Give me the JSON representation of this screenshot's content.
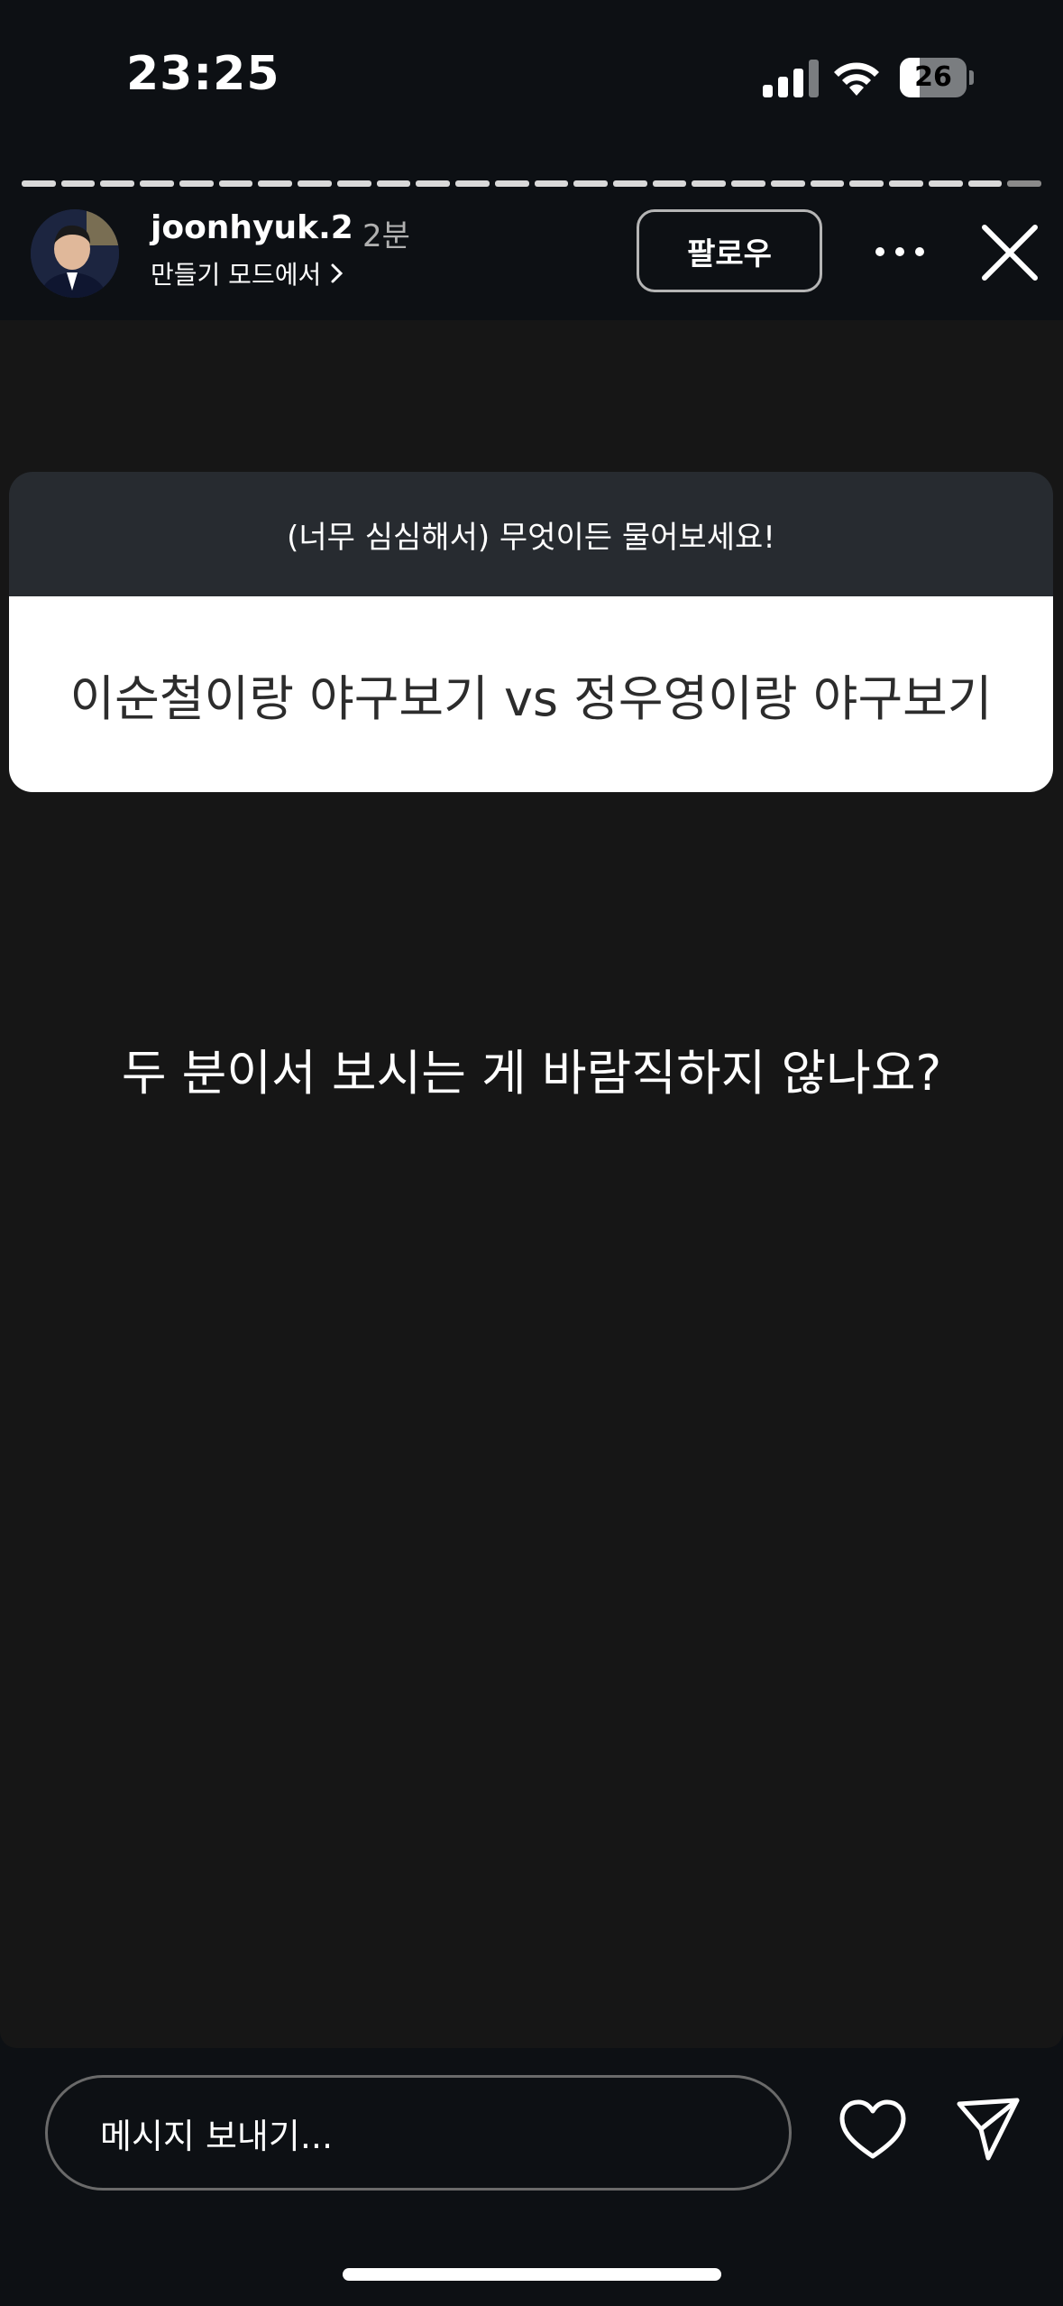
{
  "status_bar": {
    "time": "23:25",
    "battery_level": "26",
    "icons": [
      "signal-icon",
      "wifi-icon",
      "battery-icon"
    ]
  },
  "story": {
    "progress_segments": 26,
    "progress_completed": 25,
    "username": "joonhyuk.2",
    "timestamp": "2분",
    "subtitle": "만들기 모드에서",
    "follow_label": "팔로우",
    "question_prompt": "(너무 심심해서) 무엇이든 물어보세요!",
    "question_text": "이순철이랑 야구보기 vs 정우영이랑 야구보기",
    "answer_text": "두 분이서 보시는 게 바람직하지 않나요?"
  },
  "bottom_bar": {
    "message_placeholder": "메시지 보내기..."
  },
  "colors": {
    "background": "#0d1014",
    "story_background": "#161616",
    "question_header": "#272b30",
    "question_body": "#ffffff"
  }
}
